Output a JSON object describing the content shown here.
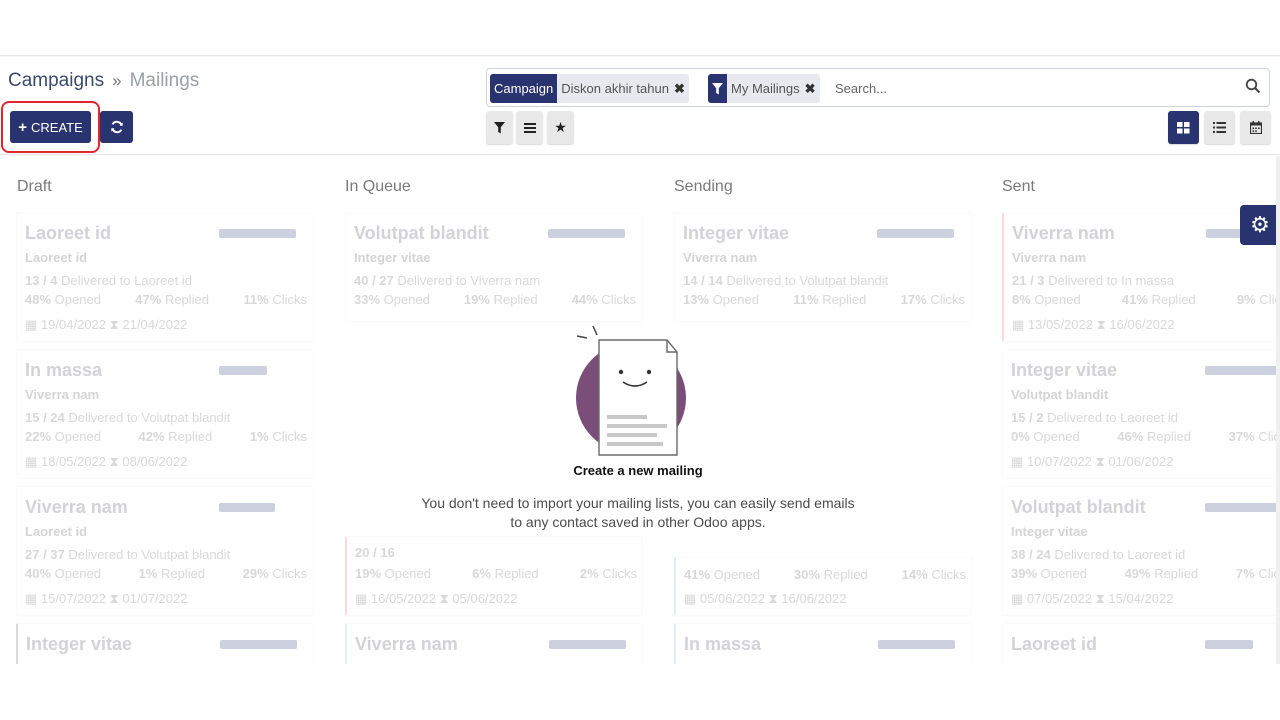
{
  "breadcrumb": {
    "parent": "Campaigns",
    "separator": "»",
    "current": "Mailings"
  },
  "buttons": {
    "create": "CREATE"
  },
  "search": {
    "facets": [
      {
        "category": "Campaign",
        "value": "Diskon akhir tahun"
      },
      {
        "category": "",
        "value": "My Mailings"
      }
    ],
    "placeholder": "Search..."
  },
  "columns": [
    {
      "title": "Draft",
      "cards": [
        {
          "name": "Laoreet id",
          "sub": "Laoreet id",
          "line_num": "13 / 4",
          "line_text": "Delivered to Laoreet id",
          "opened": "48%",
          "replied": "47%",
          "clicks": "11%",
          "date1": "19/04/2022",
          "date2": "21/04/2022"
        },
        {
          "name": "In massa",
          "sub": "Viverra nam",
          "line_num": "15 / 24",
          "line_text": "Delivered to Volutpat blandit",
          "opened": "22%",
          "replied": "42%",
          "clicks": "1%",
          "date1": "18/05/2022",
          "date2": "08/06/2022"
        },
        {
          "name": "Viverra nam",
          "sub": "Laoreet id",
          "line_num": "27 / 37",
          "line_text": "Delivered to Volutpat blandit",
          "opened": "40%",
          "replied": "1%",
          "clicks": "29%",
          "date1": "15/07/2022",
          "date2": "01/07/2022"
        },
        {
          "name": "Integer vitae",
          "sub": "",
          "line_num": "",
          "line_text": "",
          "opened": "",
          "replied": "",
          "clicks": "",
          "date1": "",
          "date2": ""
        }
      ]
    },
    {
      "title": "In Queue",
      "cards": [
        {
          "name": "Volutpat blandit",
          "sub": "Integer vitae",
          "line_num": "40 / 27",
          "line_text": "Delivered to Viverra nam",
          "opened": "33%",
          "replied": "19%",
          "clicks": "44%",
          "date1": "",
          "date2": ""
        },
        {
          "name": "",
          "sub": "",
          "line_num": "20 / 16",
          "line_text": "",
          "opened": "19%",
          "replied": "6%",
          "clicks": "2%",
          "date1": "16/05/2022",
          "date2": "05/06/2022"
        },
        {
          "name": "Viverra nam",
          "sub": "",
          "line_num": "",
          "line_text": "",
          "opened": "",
          "replied": "",
          "clicks": "",
          "date1": "",
          "date2": ""
        }
      ]
    },
    {
      "title": "Sending",
      "cards": [
        {
          "name": "Integer vitae",
          "sub": "Viverra nam",
          "line_num": "14 / 14",
          "line_text": "Delivered to Volutpat blandit",
          "opened": "13%",
          "replied": "11%",
          "clicks": "17%",
          "date1": "",
          "date2": ""
        },
        {
          "name": "",
          "sub": "",
          "line_num": "",
          "line_text": "",
          "opened": "41%",
          "replied": "30%",
          "clicks": "14%",
          "date1": "05/06/2022",
          "date2": "16/06/2022"
        },
        {
          "name": "In massa",
          "sub": "",
          "line_num": "",
          "line_text": "",
          "opened": "",
          "replied": "",
          "clicks": "",
          "date1": "",
          "date2": ""
        }
      ]
    },
    {
      "title": "Sent",
      "cards": [
        {
          "name": "Viverra nam",
          "sub": "Viverra nam",
          "line_num": "21 / 3",
          "line_text": "Delivered to In massa",
          "opened": "8%",
          "replied": "41%",
          "clicks": "9%",
          "date1": "13/05/2022",
          "date2": "16/06/2022"
        },
        {
          "name": "Integer vitae",
          "sub": "Volutpat blandit",
          "line_num": "15 / 2",
          "line_text": "Delivered to Laoreet id",
          "opened": "0%",
          "replied": "46%",
          "clicks": "37%",
          "date1": "10/07/2022",
          "date2": "01/06/2022"
        },
        {
          "name": "Volutpat blandit",
          "sub": "Integer vitae",
          "line_num": "38 / 24",
          "line_text": "Delivered to Laoreet id",
          "opened": "39%",
          "replied": "49%",
          "clicks": "7%",
          "date1": "07/05/2022",
          "date2": "15/04/2022"
        },
        {
          "name": "Laoreet id",
          "sub": "",
          "line_num": "",
          "line_text": "",
          "opened": "",
          "replied": "",
          "clicks": "",
          "date1": "",
          "date2": ""
        }
      ]
    }
  ],
  "labels": {
    "opened": "Opened",
    "replied": "Replied",
    "clicks": "Clicks"
  },
  "helper": {
    "title": "Create a new mailing",
    "text_line1": "You don't need to import your mailing lists, you can easily send emails",
    "text_line2": "to any contact saved in other Odoo apps."
  },
  "colors": {
    "primary": "#29336f",
    "highlight": "#e1262d",
    "illustration": "#7a4e78"
  },
  "icons": [
    "refresh-icon",
    "filter-icon",
    "group-by-icon",
    "favorite-star-icon",
    "search-icon",
    "kanban-view-icon",
    "list-view-icon",
    "calendar-view-icon",
    "settings-gear-icon"
  ]
}
